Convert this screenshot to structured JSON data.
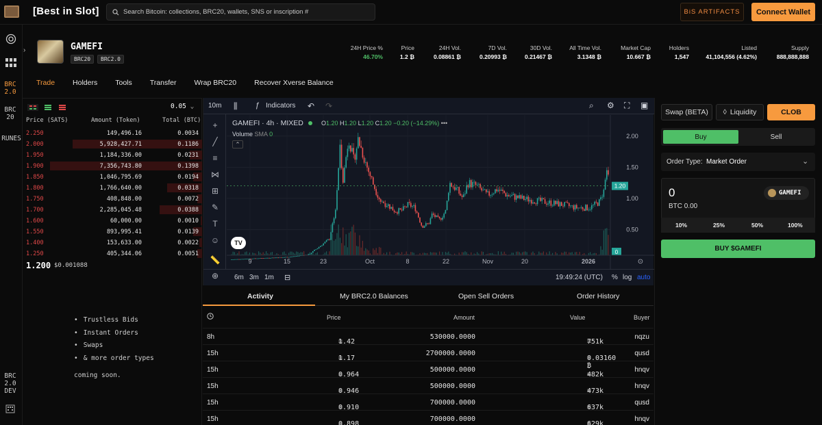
{
  "topbar": {
    "brand": "[Best in Slot]",
    "search_placeholder": "Search Bitcoin: collections, BRC20, wallets, SNS or inscription #",
    "artifacts_label": "BiS ARTIFACTS",
    "wallet_label": "Connect Wallet"
  },
  "rail": {
    "brc20": "BRC 2.0",
    "brc": "BRC 20",
    "runes": "RUNES",
    "dev": "BRC 2.0 DEV"
  },
  "token": {
    "name": "GAMEFI",
    "tags": [
      "BRC20",
      "BRC2.0"
    ]
  },
  "stats": [
    {
      "label": "24H Price %",
      "value": "46.70%",
      "color": "#4fbf67"
    },
    {
      "label": "Price",
      "value": "1.2 ₿"
    },
    {
      "label": "24H Vol.",
      "value": "0.08861 ₿"
    },
    {
      "label": "7D Vol.",
      "value": "0.20993 ₿"
    },
    {
      "label": "30D Vol.",
      "value": "0.21467 ₿"
    },
    {
      "label": "All Time Vol.",
      "value": "3.1348 ₿"
    },
    {
      "label": "Market Cap",
      "value": "10.667 ₿"
    },
    {
      "label": "Holders",
      "value": "1,547"
    },
    {
      "label": "Listed",
      "value": "41,104,556 (4.62%)"
    },
    {
      "label": "Supply",
      "value": "888,888,888"
    }
  ],
  "nav": [
    "Trade",
    "Holders",
    "Tools",
    "Transfer",
    "Wrap BRC20",
    "Recover Xverse Balance"
  ],
  "orderbook": {
    "step": "0.05",
    "headers": {
      "price": "Price (SATS)",
      "amount": "Amount (Token)",
      "total": "Total (BTC)"
    },
    "rows": [
      {
        "price": "2.250",
        "amount": "149,496.16",
        "total": "0.0034",
        "depth": 0.0
      },
      {
        "price": "2.000",
        "amount": "5,928,427.71",
        "total": "0.1186",
        "depth": 0.85
      },
      {
        "price": "1.950",
        "amount": "1,184,336.00",
        "total": "0.0231",
        "depth": 0.08
      },
      {
        "price": "1.900",
        "amount": "7,356,743.80",
        "total": "0.1398",
        "depth": 1.0
      },
      {
        "price": "1.850",
        "amount": "1,046,795.69",
        "total": "0.0194",
        "depth": 0.06
      },
      {
        "price": "1.800",
        "amount": "1,766,640.00",
        "total": "0.0318",
        "depth": 0.23
      },
      {
        "price": "1.750",
        "amount": "408,848.00",
        "total": "0.0072",
        "depth": 0.03
      },
      {
        "price": "1.700",
        "amount": "2,285,045.48",
        "total": "0.0388",
        "depth": 0.28
      },
      {
        "price": "1.600",
        "amount": "60,000.00",
        "total": "0.0010",
        "depth": 0.01
      },
      {
        "price": "1.550",
        "amount": "893,995.41",
        "total": "0.0139",
        "depth": 0.06
      },
      {
        "price": "1.400",
        "amount": "153,633.00",
        "total": "0.0022",
        "depth": 0.02
      },
      {
        "price": "1.250",
        "amount": "405,344.06",
        "total": "0.0051",
        "depth": 0.03
      }
    ],
    "last_price": "1.200",
    "last_sub": "$0.001088",
    "features": [
      "Trustless Bids",
      "Instant Orders",
      "Swaps",
      "& more order types"
    ],
    "coming_soon": "coming soon."
  },
  "chart": {
    "interval": "10m",
    "indicators": "Indicators",
    "symbol": "GAMEFI · 4h · MIXED",
    "ohlc": {
      "o": "1.20",
      "h": "1.20",
      "l": "1.20",
      "c": "1.20",
      "chg": "−0.20 (−14.29%)"
    },
    "volume_label": "Volume",
    "sma": "SMA",
    "sma_val": "0",
    "y_ticks": [
      "2.00",
      "1.50",
      "1.00",
      "0.50"
    ],
    "current_price": "1.20",
    "vol_label": "0",
    "x_ticks": [
      "9",
      "15",
      "23",
      "Oct",
      "8",
      "22",
      "Nov",
      "20",
      "2026"
    ],
    "ranges": [
      "6m",
      "3m",
      "1m"
    ],
    "time": "19:49:24 (UTC)",
    "pct": "%",
    "log": "log",
    "auto": "auto"
  },
  "activity": {
    "tabs": [
      "Activity",
      "My BRC2.0 Balances",
      "Open Sell Orders",
      "Order History"
    ],
    "headers": {
      "price": "Price",
      "amount": "Amount",
      "value": "Value",
      "buyer": "Buyer"
    },
    "rows": [
      {
        "time": "8h",
        "price": "1.42",
        "amount": "530000.0000",
        "value": "751k",
        "buyer": "nqzu"
      },
      {
        "time": "15h",
        "price": "1.17",
        "amount": "2700000.0000",
        "value": "0.03160 ₿",
        "buyer": "qusd"
      },
      {
        "time": "15h",
        "price": "0.964",
        "amount": "500000.0000",
        "value": "482k",
        "buyer": "hnqv"
      },
      {
        "time": "15h",
        "price": "0.946",
        "amount": "500000.0000",
        "value": "473k",
        "buyer": "hnqv"
      },
      {
        "time": "15h",
        "price": "0.910",
        "amount": "700000.0000",
        "value": "637k",
        "buyer": "qusd"
      },
      {
        "time": "15h",
        "price": "0.898",
        "amount": "700000.0000",
        "value": "629k",
        "buyer": "hnqv"
      }
    ]
  },
  "trade": {
    "swap": "Swap (BETA)",
    "liquidity": "Liquidity",
    "clob": "CLOB",
    "buy": "Buy",
    "sell": "Sell",
    "order_type_label": "Order Type:",
    "order_type": "Market Order",
    "amount": "0",
    "btc": "BTC 0.00",
    "token_chip": "GAMEFI",
    "pcts": [
      "10%",
      "25%",
      "50%",
      "100%"
    ],
    "buy_btn": "BUY $GAMEFI"
  }
}
